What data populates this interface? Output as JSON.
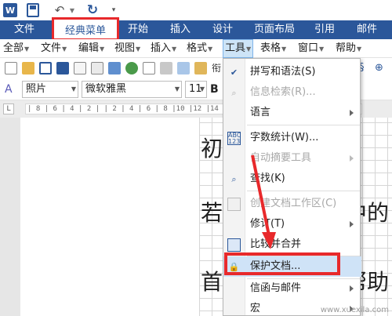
{
  "quick_access": {
    "app_letter": "W",
    "icons": [
      "word-logo-icon",
      "save-icon",
      "undo-icon",
      "redo-icon",
      "customize-qat-icon"
    ]
  },
  "ribbon": {
    "tabs": [
      "文件",
      "经典菜单",
      "开始",
      "插入",
      "设计",
      "页面布局",
      "引用",
      "邮件"
    ],
    "bg_color": "#2b579a"
  },
  "menubar": {
    "items": [
      "全部",
      "文件",
      "编辑",
      "视图",
      "插入",
      "格式",
      "工具",
      "表格",
      "窗口",
      "帮助"
    ]
  },
  "format_bar": {
    "style_value": "照片",
    "font_value": "微软雅黑",
    "size_value": "11",
    "bold_label": "B"
  },
  "ruler": {
    "corner_label": "L",
    "marks": "| 8 | 6 | 4 | 2 |   | 2 | 4 | 6 | 8 |10 |12 |14 |16 |18 |20 |22 |"
  },
  "document": {
    "lines": [
      "初",
      "若",
      "首"
    ],
    "right_fragments": [
      "中的",
      "帮助"
    ]
  },
  "tools_menu": {
    "items": [
      {
        "label": "拼写和语法(S)",
        "enabled": true,
        "submenu": false,
        "icon": "spellcheck-icon"
      },
      {
        "label": "信息检索(R)...",
        "enabled": false,
        "submenu": false,
        "icon": "research-icon"
      },
      {
        "label": "语言",
        "enabled": true,
        "submenu": true,
        "icon": ""
      },
      {
        "label": "字数统计(W)...",
        "enabled": true,
        "submenu": false,
        "icon": "word-count-icon"
      },
      {
        "label": "自动摘要工具",
        "enabled": false,
        "submenu": true,
        "icon": ""
      },
      {
        "label": "查找(K)",
        "enabled": true,
        "submenu": false,
        "icon": "find-icon"
      },
      {
        "label": "创建文档工作区(C)",
        "enabled": false,
        "submenu": false,
        "icon": "doc-workspace-icon"
      },
      {
        "label": "修订(T)",
        "enabled": true,
        "submenu": true,
        "icon": ""
      },
      {
        "label": "比较并合并",
        "enabled": true,
        "submenu": false,
        "icon": "compare-icon"
      },
      {
        "label": "保护文档...",
        "enabled": true,
        "submenu": false,
        "icon": "lock-document-icon"
      },
      {
        "label": "信函与邮件",
        "enabled": true,
        "submenu": true,
        "icon": ""
      },
      {
        "label": "宏",
        "enabled": true,
        "submenu": true,
        "icon": ""
      }
    ],
    "highlight_color": "#cfe3f7"
  },
  "annotations": {
    "color": "#e8292b"
  },
  "watermark": "www.xuexila.com"
}
